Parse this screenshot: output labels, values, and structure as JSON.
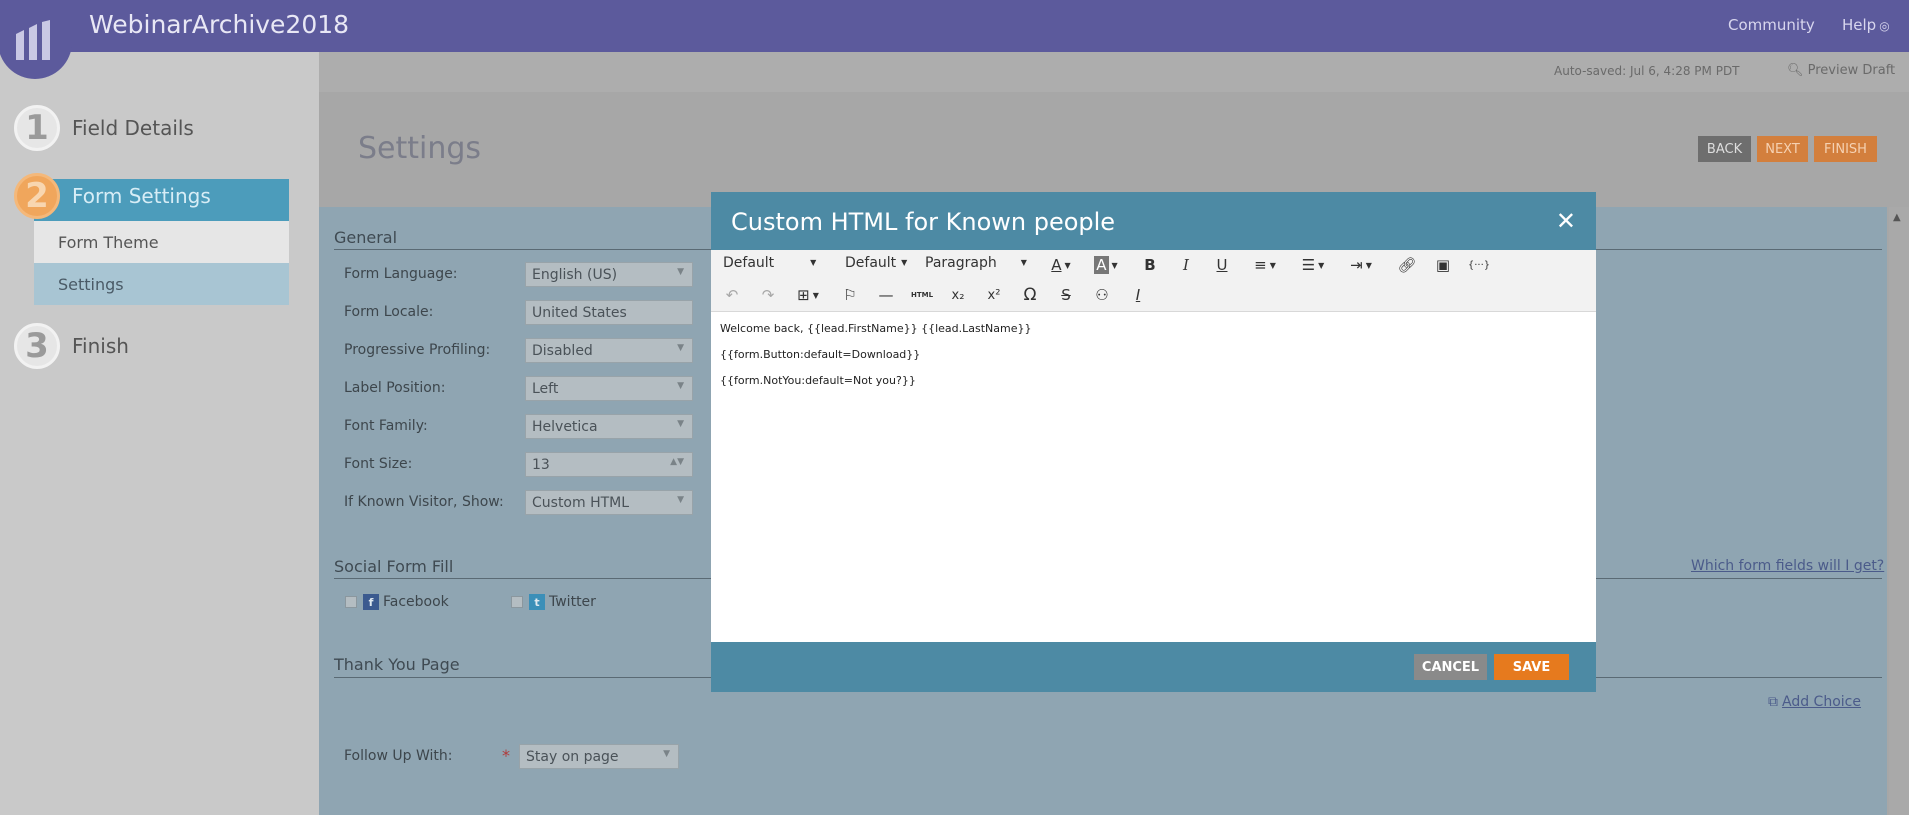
{
  "app": {
    "title": "WebinarArchive2018"
  },
  "topnav": {
    "community": "Community",
    "help": "Help"
  },
  "steps": [
    {
      "num": "1",
      "label": "Field Details"
    },
    {
      "num": "2",
      "label": "Form Settings"
    },
    {
      "num": "3",
      "label": "Finish"
    }
  ],
  "substeps": {
    "theme": "Form Theme",
    "settings": "Settings"
  },
  "header": {
    "autosaved": "Auto-saved: Jul 6, 4:28 PM PDT",
    "preview": "Preview Draft",
    "title": "Settings",
    "back": "BACK",
    "next": "NEXT",
    "finish": "FINISH"
  },
  "general": {
    "heading": "General",
    "fields": [
      {
        "label": "Form Language:",
        "value": "English (US)"
      },
      {
        "label": "Form Locale:",
        "value": "United States"
      },
      {
        "label": "Progressive Profiling:",
        "value": "Disabled"
      },
      {
        "label": "Label Position:",
        "value": "Left"
      },
      {
        "label": "Font Family:",
        "value": "Helvetica"
      },
      {
        "label": "Font Size:",
        "value": "13"
      },
      {
        "label": "If Known Visitor, Show:",
        "value": "Custom HTML"
      }
    ]
  },
  "social": {
    "heading": "Social Form Fill",
    "facebook": "Facebook",
    "twitter": "Twitter",
    "which_link": "Which form fields will I get?"
  },
  "thankyou": {
    "heading": "Thank You Page",
    "add_choice": "Add Choice",
    "follow_label": "Follow Up With:",
    "follow_value": "Stay on page",
    "required_mark": "*"
  },
  "modal": {
    "title": "Custom HTML for Known people",
    "toolbar": {
      "font_dd": "Default",
      "size_dd": "Default",
      "block_dd": "Paragraph",
      "html_btn": "HTML"
    },
    "content": [
      "Welcome back, {{lead.FirstName}} {{lead.LastName}}",
      "{{form.Button:default=Download}}",
      "{{form.NotYou:default=Not you?}}"
    ],
    "cancel": "CANCEL",
    "save": "SAVE"
  },
  "colors": {
    "topbar": "#5c5a9c",
    "modal_header": "#4d8aa4",
    "save": "#e67a1e",
    "cancel": "#8a8a8a"
  }
}
